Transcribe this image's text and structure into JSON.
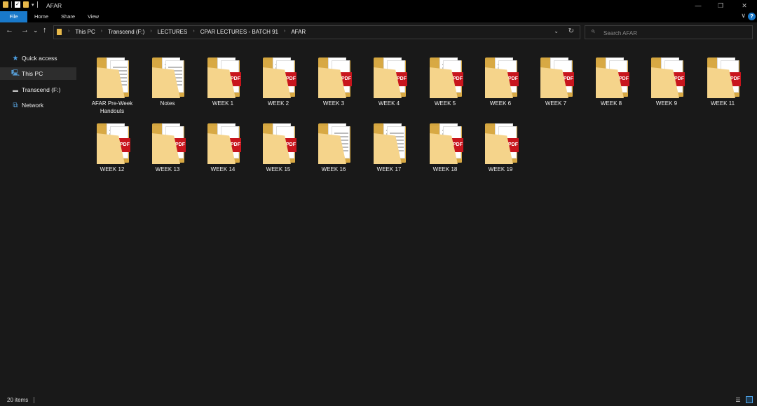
{
  "window": {
    "title": "AFAR",
    "qat_check": "✓",
    "qat_dropdown": "▾",
    "minimize": "—",
    "maximize": "❐",
    "close": "✕"
  },
  "ribbon": {
    "tabs": [
      "File",
      "Home",
      "Share",
      "View"
    ],
    "expand_glyph": "∨",
    "help_glyph": "?"
  },
  "address_bar": {
    "back": "←",
    "forward": "→",
    "recent": "⌄",
    "up": "↑",
    "breadcrumbs": [
      "This PC",
      "Transcend (F:)",
      "LECTURES",
      "CPAR LECTURES - BATCH 91",
      "AFAR"
    ],
    "separator": "›",
    "dropdown": "⌄",
    "refresh": "↻"
  },
  "search": {
    "placeholder": "Search AFAR",
    "icon": "⌕"
  },
  "sidebar": {
    "items": [
      {
        "label": "Quick access",
        "icon": "★"
      },
      {
        "label": "This PC",
        "icon": "🖳"
      },
      {
        "label": "Transcend (F:)",
        "icon": "▬"
      },
      {
        "label": "Network",
        "icon": "⧉"
      }
    ]
  },
  "folders": [
    {
      "name": "AFAR Pre-Week Handouts",
      "thumb": "seal"
    },
    {
      "name": "Notes",
      "thumb": "doc"
    },
    {
      "name": "WEEK 1",
      "thumb": "pdf"
    },
    {
      "name": "WEEK 2",
      "thumb": "pdfdoc"
    },
    {
      "name": "WEEK 3",
      "thumb": "pdf"
    },
    {
      "name": "WEEK 4",
      "thumb": "pdf"
    },
    {
      "name": "WEEK 5",
      "thumb": "pdfdoc"
    },
    {
      "name": "WEEK 6",
      "thumb": "pdfdoc"
    },
    {
      "name": "WEEK 7",
      "thumb": "pdf"
    },
    {
      "name": "WEEK 8",
      "thumb": "pdf"
    },
    {
      "name": "WEEK 9",
      "thumb": "pdf"
    },
    {
      "name": "WEEK 11",
      "thumb": "pdf"
    },
    {
      "name": "WEEK 12",
      "thumb": "pdfdoc"
    },
    {
      "name": "WEEK 13",
      "thumb": "pdf"
    },
    {
      "name": "WEEK 14",
      "thumb": "pdf"
    },
    {
      "name": "WEEK 15",
      "thumb": "sealpdf"
    },
    {
      "name": "WEEK 16",
      "thumb": "seal"
    },
    {
      "name": "WEEK 17",
      "thumb": "doc"
    },
    {
      "name": "WEEK 18",
      "thumb": "pdfdoc"
    },
    {
      "name": "WEEK 19",
      "thumb": "pdf"
    }
  ],
  "pdf_label": "PDF",
  "status": {
    "item_count": "20 items",
    "details_glyph": "☰"
  },
  "colors": {
    "accent": "#1979ca",
    "folder": "#e7b84a",
    "pdf": "#c8151d",
    "background": "#191919"
  }
}
